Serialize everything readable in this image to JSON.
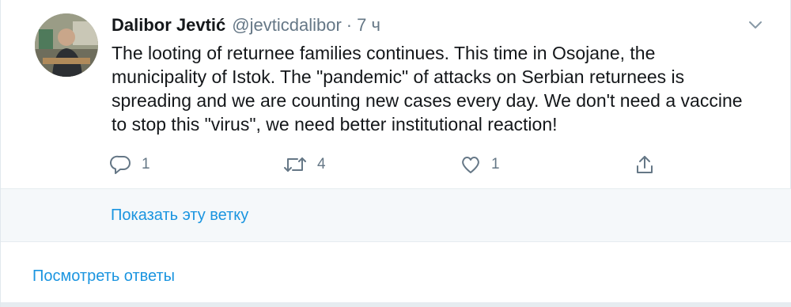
{
  "tweet": {
    "author_name": "Dalibor Jevtić",
    "handle": "@jevticdalibor",
    "separator": "·",
    "time": "7 ч",
    "text": "The looting of returnee families continues. This time in Osojane, the municipality of Istok. The \"pandemic\" of attacks on Serbian returnees is spreading and we are counting new cases every day. We don't need a vaccine to stop this \"virus\", we need better institutional reaction!",
    "actions": {
      "reply_count": "1",
      "retweet_count": "4",
      "like_count": "1"
    },
    "icons": [
      "avatar",
      "chevron-down-icon",
      "reply-icon",
      "retweet-icon",
      "like-icon",
      "share-icon"
    ]
  },
  "thread": {
    "show_thread_label": "Показать эту ветку"
  },
  "replies": {
    "view_replies_label": "Посмотреть ответы"
  },
  "colors": {
    "link": "#1b95e0",
    "muted": "#657786",
    "text": "#14171a",
    "panel": "#f5f8fa"
  }
}
